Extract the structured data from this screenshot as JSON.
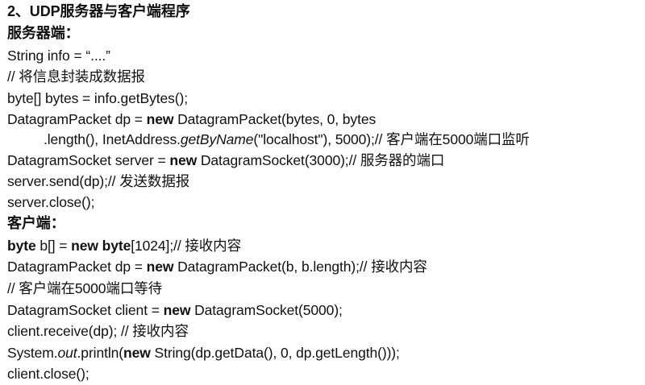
{
  "title": "2、UDP服务器与客户端程序",
  "server": {
    "heading": "服务器端：",
    "code": {
      "l1": "String info = “....”",
      "l2": "// 将信息封装成数据报",
      "l3": "byte[] bytes = info.getBytes();",
      "l4": {
        "a": "DatagramPacket dp = ",
        "kw": "new",
        "b": " DatagramPacket(bytes, 0, bytes"
      },
      "l5": {
        "a": ".length(), InetAddress.",
        "it": "getByName",
        "b": "(\"localhost\"), 5000);// 客户端在5000端口监听"
      },
      "l6": {
        "a": "DatagramSocket server = ",
        "kw": "new",
        "b": " DatagramSocket(3000);// 服务器的端口"
      },
      "l7": "server.send(dp);// 发送数据报",
      "l8": "server.close();"
    }
  },
  "client": {
    "heading": "客户端：",
    "code": {
      "l1": {
        "kw1": "byte",
        "a": " b[] = ",
        "kw2": "new byte",
        "b": "[1024];// 接收内容"
      },
      "l2": {
        "a": "DatagramPacket dp = ",
        "kw": "new",
        "b": " DatagramPacket(b, b.length);// 接收内容"
      },
      "l3": "// 客户端在5000端口等待",
      "l4": {
        "a": "DatagramSocket client = ",
        "kw": "new",
        "b": " DatagramSocket(5000);"
      },
      "l5": "client.receive(dp); // 接收内容",
      "l6": {
        "a": "System.",
        "it": "out",
        "b": ".println(",
        "kw": "new",
        "c": " String(dp.getData(), 0, dp.getLength()));"
      },
      "l7": "client.close();"
    }
  }
}
